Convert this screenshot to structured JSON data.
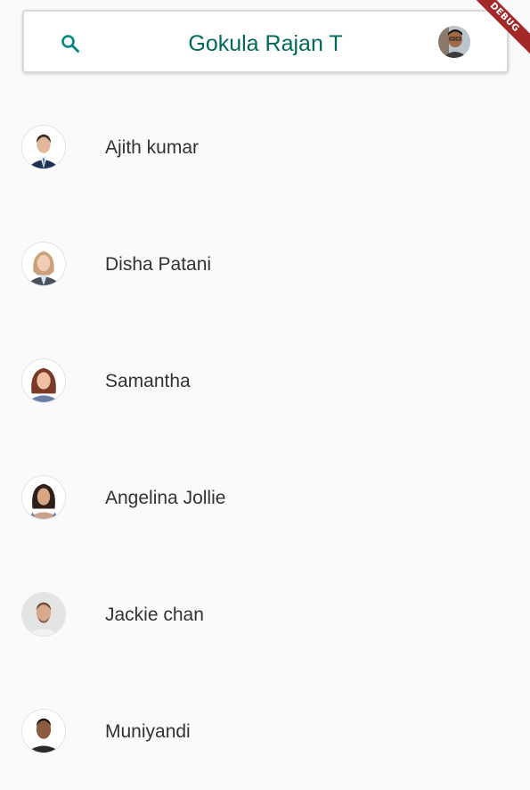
{
  "search_bar": {
    "title": "Gokula Rajan T",
    "search_icon": "search-icon",
    "profile_avatar": "user-avatar"
  },
  "debug_banner": {
    "label": "DEBUG"
  },
  "colors": {
    "accent": "#00695c",
    "search_icon": "#00897b",
    "debug": "#a32929",
    "background": "#fafafa"
  },
  "contacts": [
    {
      "name": "Ajith kumar"
    },
    {
      "name": "Disha Patani"
    },
    {
      "name": "Samantha"
    },
    {
      "name": "Angelina Jollie"
    },
    {
      "name": "Jackie chan"
    },
    {
      "name": "Muniyandi"
    }
  ]
}
